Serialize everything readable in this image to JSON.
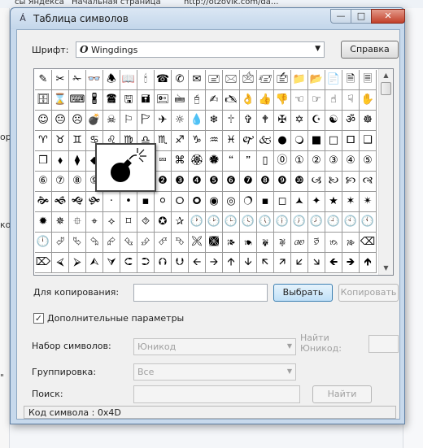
{
  "background": {
    "bookmarks": [
      "сы Яндекса",
      "Начальная страница",
      "http://otzovik.com/da..."
    ],
    "left_fragments": [
      "ор",
      "ко",
      "\""
    ]
  },
  "window": {
    "title": "Таблица символов",
    "controls": {
      "minimize": "—",
      "maximize": "□",
      "close": "✕"
    }
  },
  "font": {
    "label": "Шрифт:",
    "value": "Wingdings",
    "help_button": "Справка"
  },
  "grid": {
    "symbols": [
      "✎",
      "✂",
      "✁",
      "👓",
      "🕭",
      "📖",
      "🕯",
      "☎",
      "✆",
      "✉",
      "🖃",
      "🖂",
      "🖄",
      "🖅",
      "🖆",
      "📁",
      "📂",
      "📄",
      "🗎",
      "🗏",
      "🗄",
      "⌛",
      "⌨",
      "🖁",
      "🖀",
      "🖫",
      "🖬",
      "🖭",
      "🖮",
      "🖯",
      "✍",
      "🖎",
      "👌",
      "👍",
      "👎",
      "☜",
      "☞",
      "☝",
      "☟",
      "✋",
      "☺",
      "😐",
      "☹",
      "💣",
      "☠",
      "⚐",
      "🏱",
      "✈",
      "☼",
      "💧",
      "❄",
      "🕆",
      "✞",
      "🕈",
      "✠",
      "✡",
      "☪",
      "☯",
      "ॐ",
      "☸",
      "♈",
      "♉",
      "♊",
      "♋",
      "♌",
      "♍",
      "♎",
      "♏",
      "♐",
      "♑",
      "♒",
      "♓",
      "🙰",
      "🙵",
      "●",
      "🔾",
      "■",
      "□",
      "🞐",
      "❑",
      "❒",
      "⬧",
      "⧫",
      "◆",
      "❖",
      "⬥",
      "⌧",
      "⮹",
      "⌘",
      "🏵",
      "🏶",
      "🙶",
      "🙷",
      "▯",
      "⓪",
      "①",
      "②",
      "③",
      "④",
      "⑤",
      "⑥",
      "⑦",
      "⑧",
      "⑨",
      "⑩",
      "⓿",
      "❶",
      "❷",
      "❸",
      "❹",
      "❺",
      "❻",
      "❼",
      "❽",
      "❾",
      "❿",
      "🙢",
      "🙠",
      "🙡",
      "🙣",
      "🙞",
      "🙜",
      "🙝",
      "🙟",
      "·",
      "•",
      "▪",
      "⚪",
      "🞆",
      "🞈",
      "◉",
      "◎",
      "🔿",
      "▪",
      "◻",
      "🟂",
      "✦",
      "★",
      "✶",
      "✴",
      "✹",
      "✵",
      "⯐",
      "⌖",
      "⟡",
      "⌑",
      "⯑",
      "✪",
      "✰",
      "🕐",
      "🕑",
      "🕒",
      "🕓",
      "🕔",
      "🕕",
      "🕖",
      "🕗",
      "🕘",
      "🕙",
      "🕚",
      "🕛",
      "⮰",
      "⮱",
      "⮲",
      "⮳",
      "⮴",
      "⮵",
      "⮶",
      "⮷",
      "🙪",
      "🙫",
      "🙕",
      "🙔",
      "🙗",
      "🙖",
      "🙐",
      "🙑",
      "🙒",
      "🙓",
      "⌫",
      "⌦",
      "⮘",
      "⮚",
      "⮙",
      "⮛",
      "⮈",
      "⮊",
      "⮉",
      "⮋",
      "🡨",
      "🡪",
      "🡩",
      "🡫",
      "🡬",
      "🡭",
      "🡯",
      "🡮",
      "🡸",
      "🡺",
      "🡹"
    ],
    "zoom_symbol": "💣"
  },
  "copy": {
    "label": "Для копирования:",
    "value": "",
    "select_button": "Выбрать",
    "copy_button": "Копировать"
  },
  "advanced": {
    "checkbox_label": "Дополнительные параметры",
    "checked": true,
    "charset_label": "Набор символов:",
    "charset_value": "Юникод",
    "find_unicode_label_1": "Найти",
    "find_unicode_label_2": "Юникод:",
    "find_unicode_value": "",
    "group_label": "Группировка:",
    "group_value": "Все",
    "search_label": "Поиск:",
    "search_value": "",
    "find_button": "Найти"
  },
  "status": {
    "text": "Код символа : 0x4D"
  },
  "colors": {
    "window_frame": "#c7d9ec",
    "dialog_bg": "#f0f0f0",
    "primary_button": "#bfe0f7"
  }
}
